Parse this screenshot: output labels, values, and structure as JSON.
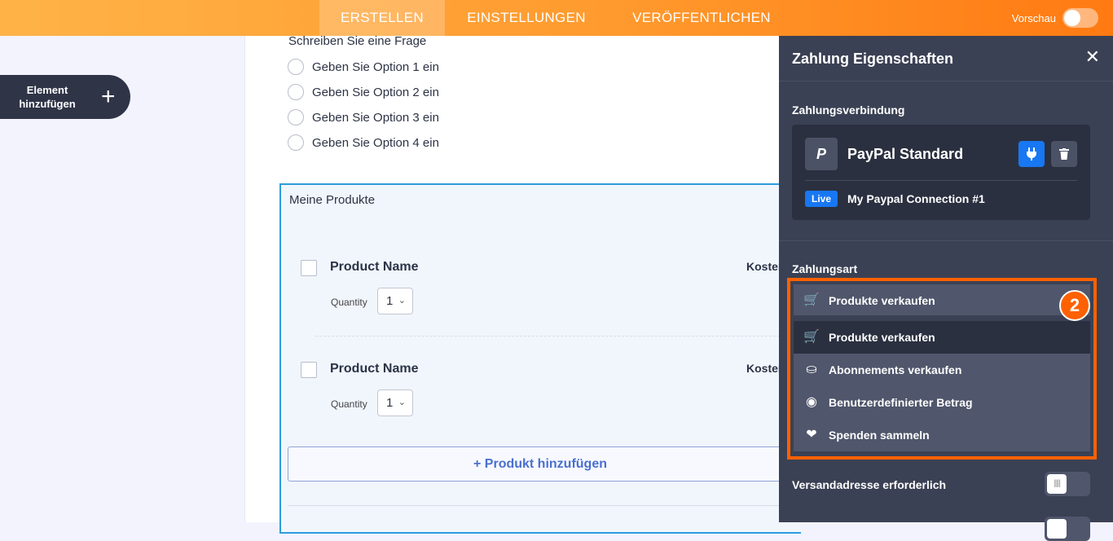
{
  "topbar": {
    "tabs": [
      "ERSTELLEN",
      "EINSTELLUNGEN",
      "VERÖFFENTLICHEN"
    ],
    "active_tab": "ERSTELLEN",
    "preview_label": "Vorschau",
    "preview_on": false
  },
  "left": {
    "add_element_label": "Element hinzufügen"
  },
  "form": {
    "question": "Schreiben Sie eine Frage",
    "options": [
      "Geben Sie Option 1 ein",
      "Geben Sie Option 2 ein",
      "Geben Sie Option 3 ein",
      "Geben Sie Option 4 ein"
    ],
    "products_title": "Meine Produkte",
    "products": [
      {
        "name": "Product Name",
        "cost_label": "Koster",
        "quantity_label": "Quantity",
        "quantity": "1"
      },
      {
        "name": "Product Name",
        "cost_label": "Koster",
        "quantity_label": "Quantity",
        "quantity": "1"
      }
    ],
    "add_product_label": "+ Produkt hinzufügen"
  },
  "panel": {
    "title": "Zahlung Eigenschaften",
    "connection_label": "Zahlungsverbindung",
    "gateway_name": "PayPal Standard",
    "gateway_logo": "P",
    "live_badge": "Live",
    "connection_name": "My Paypal Connection #1",
    "payment_type_label": "Zahlungsart",
    "selected_type": "Produkte verkaufen",
    "step_badge": "2",
    "options": [
      {
        "label": "Produkte verkaufen",
        "icon": "cart-icon"
      },
      {
        "label": "Abonnements verkaufen",
        "icon": "coins-icon"
      },
      {
        "label": "Benutzerdefinierter Betrag",
        "icon": "coin-one-icon"
      },
      {
        "label": "Spenden sammeln",
        "icon": "heart-icon"
      }
    ],
    "shipping_label": "Versandadresse erforderlich"
  },
  "colors": {
    "accent": "#ff6100",
    "blue": "#1877f2",
    "panel_bg": "#3b4154"
  }
}
